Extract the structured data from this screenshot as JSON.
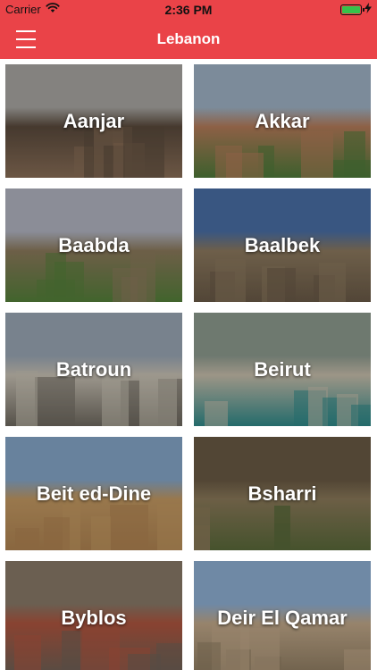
{
  "status_bar": {
    "carrier": "Carrier",
    "time": "2:36 PM",
    "battery_level": 1.0,
    "battery_color": "#36c24a"
  },
  "nav": {
    "title": "Lebanon",
    "menu_icon": "hamburger-menu-icon",
    "accent": "#ea4348"
  },
  "cities": [
    {
      "name": "Aanjar",
      "sky": "#a9a7a3",
      "ground": "#8a6f58",
      "accent": "#5a4a3c"
    },
    {
      "name": "Akkar",
      "sky": "#9fb3c6",
      "ground": "#4f7a3a",
      "accent": "#b57c5a"
    },
    {
      "name": "Baabda",
      "sky": "#b2b5c2",
      "ground": "#55803a",
      "accent": "#8c7a5c"
    },
    {
      "name": "Baalbek",
      "sky": "#4a6fa6",
      "ground": "#6a5a47",
      "accent": "#8d7a5f"
    },
    {
      "name": "Batroun",
      "sky": "#9aa7b5",
      "ground": "#6f6a60",
      "accent": "#c9c2b5"
    },
    {
      "name": "Beirut",
      "sky": "#8e9b8f",
      "ground": "#2f8a8a",
      "accent": "#c9c0ad"
    },
    {
      "name": "Beit ed-Dine",
      "sky": "#86a7c9",
      "ground": "#b08452",
      "accent": "#c49a63"
    },
    {
      "name": "Bsharri",
      "sky": "#6a5a44",
      "ground": "#5a6a3a",
      "accent": "#8b7a5a"
    },
    {
      "name": "Byblos",
      "sky": "#8a7a68",
      "ground": "#6f6257",
      "accent": "#b0563f"
    },
    {
      "name": "Deir El Qamar",
      "sky": "#8fb0d4",
      "ground": "#8f7d62",
      "accent": "#c2a98a"
    }
  ]
}
